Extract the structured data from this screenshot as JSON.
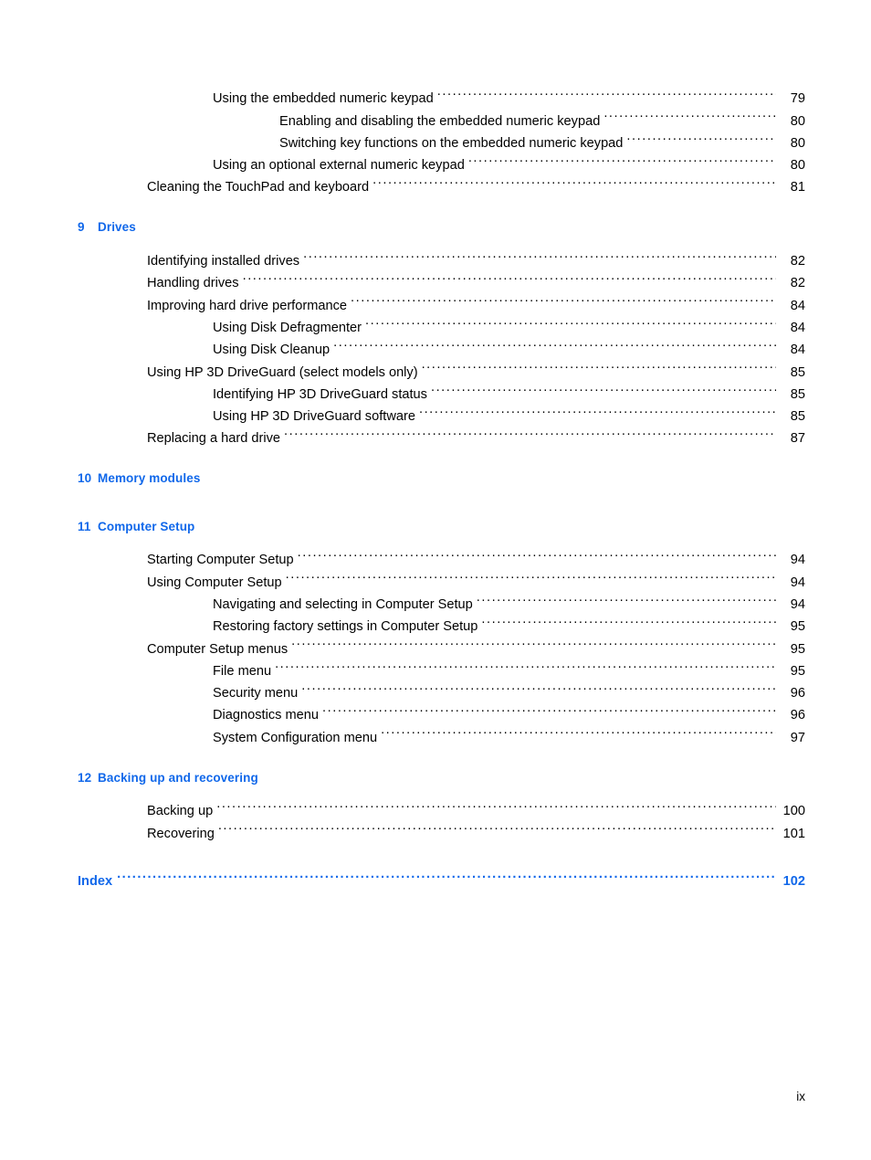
{
  "document": {
    "type": "table-of-contents",
    "footer_page_number": "ix",
    "accent_color": "#1168ea",
    "text_color": "#000000",
    "background_color": "#ffffff"
  },
  "continued_entries": [
    {
      "level": 2,
      "label": "Using the embedded numeric keypad",
      "page": "79"
    },
    {
      "level": 3,
      "label": "Enabling and disabling the embedded numeric keypad",
      "page": "80"
    },
    {
      "level": 3,
      "label": "Switching key functions on the embedded numeric keypad",
      "page": "80"
    },
    {
      "level": 2,
      "label": "Using an optional external numeric keypad",
      "page": "80"
    },
    {
      "level": 1,
      "label": "Cleaning the TouchPad and keyboard",
      "page": "81"
    }
  ],
  "chapters": [
    {
      "number": "9",
      "title": "Drives",
      "entries": [
        {
          "level": 1,
          "label": "Identifying installed drives",
          "page": "82"
        },
        {
          "level": 1,
          "label": "Handling drives",
          "page": "82"
        },
        {
          "level": 1,
          "label": "Improving hard drive performance",
          "page": "84"
        },
        {
          "level": 2,
          "label": "Using Disk Defragmenter",
          "page": "84"
        },
        {
          "level": 2,
          "label": "Using Disk Cleanup",
          "page": "84"
        },
        {
          "level": 1,
          "label": "Using HP 3D DriveGuard (select models only) ",
          "page": "85"
        },
        {
          "level": 2,
          "label": "Identifying HP 3D DriveGuard status",
          "page": "85"
        },
        {
          "level": 2,
          "label": "Using HP 3D DriveGuard software",
          "page": "85"
        },
        {
          "level": 1,
          "label": "Replacing a hard drive",
          "page": "87"
        }
      ]
    },
    {
      "number": "10",
      "title": "Memory modules",
      "entries": []
    },
    {
      "number": "11",
      "title": "Computer Setup",
      "entries": [
        {
          "level": 1,
          "label": "Starting Computer Setup",
          "page": "94"
        },
        {
          "level": 1,
          "label": "Using Computer Setup",
          "page": "94"
        },
        {
          "level": 2,
          "label": "Navigating and selecting in Computer Setup",
          "page": "94"
        },
        {
          "level": 2,
          "label": "Restoring factory settings in Computer Setup",
          "page": "95"
        },
        {
          "level": 1,
          "label": "Computer Setup menus",
          "page": "95"
        },
        {
          "level": 2,
          "label": "File menu",
          "page": "95"
        },
        {
          "level": 2,
          "label": "Security menu",
          "page": "96"
        },
        {
          "level": 2,
          "label": "Diagnostics menu",
          "page": "96"
        },
        {
          "level": 2,
          "label": "System Configuration menu",
          "page": "97"
        }
      ]
    },
    {
      "number": "12",
      "title": "Backing up and recovering",
      "entries": [
        {
          "level": 1,
          "label": "Backing up",
          "page": "100"
        },
        {
          "level": 1,
          "label": "Recovering",
          "page": "101"
        }
      ]
    }
  ],
  "index": {
    "label": "Index",
    "page": "102"
  }
}
